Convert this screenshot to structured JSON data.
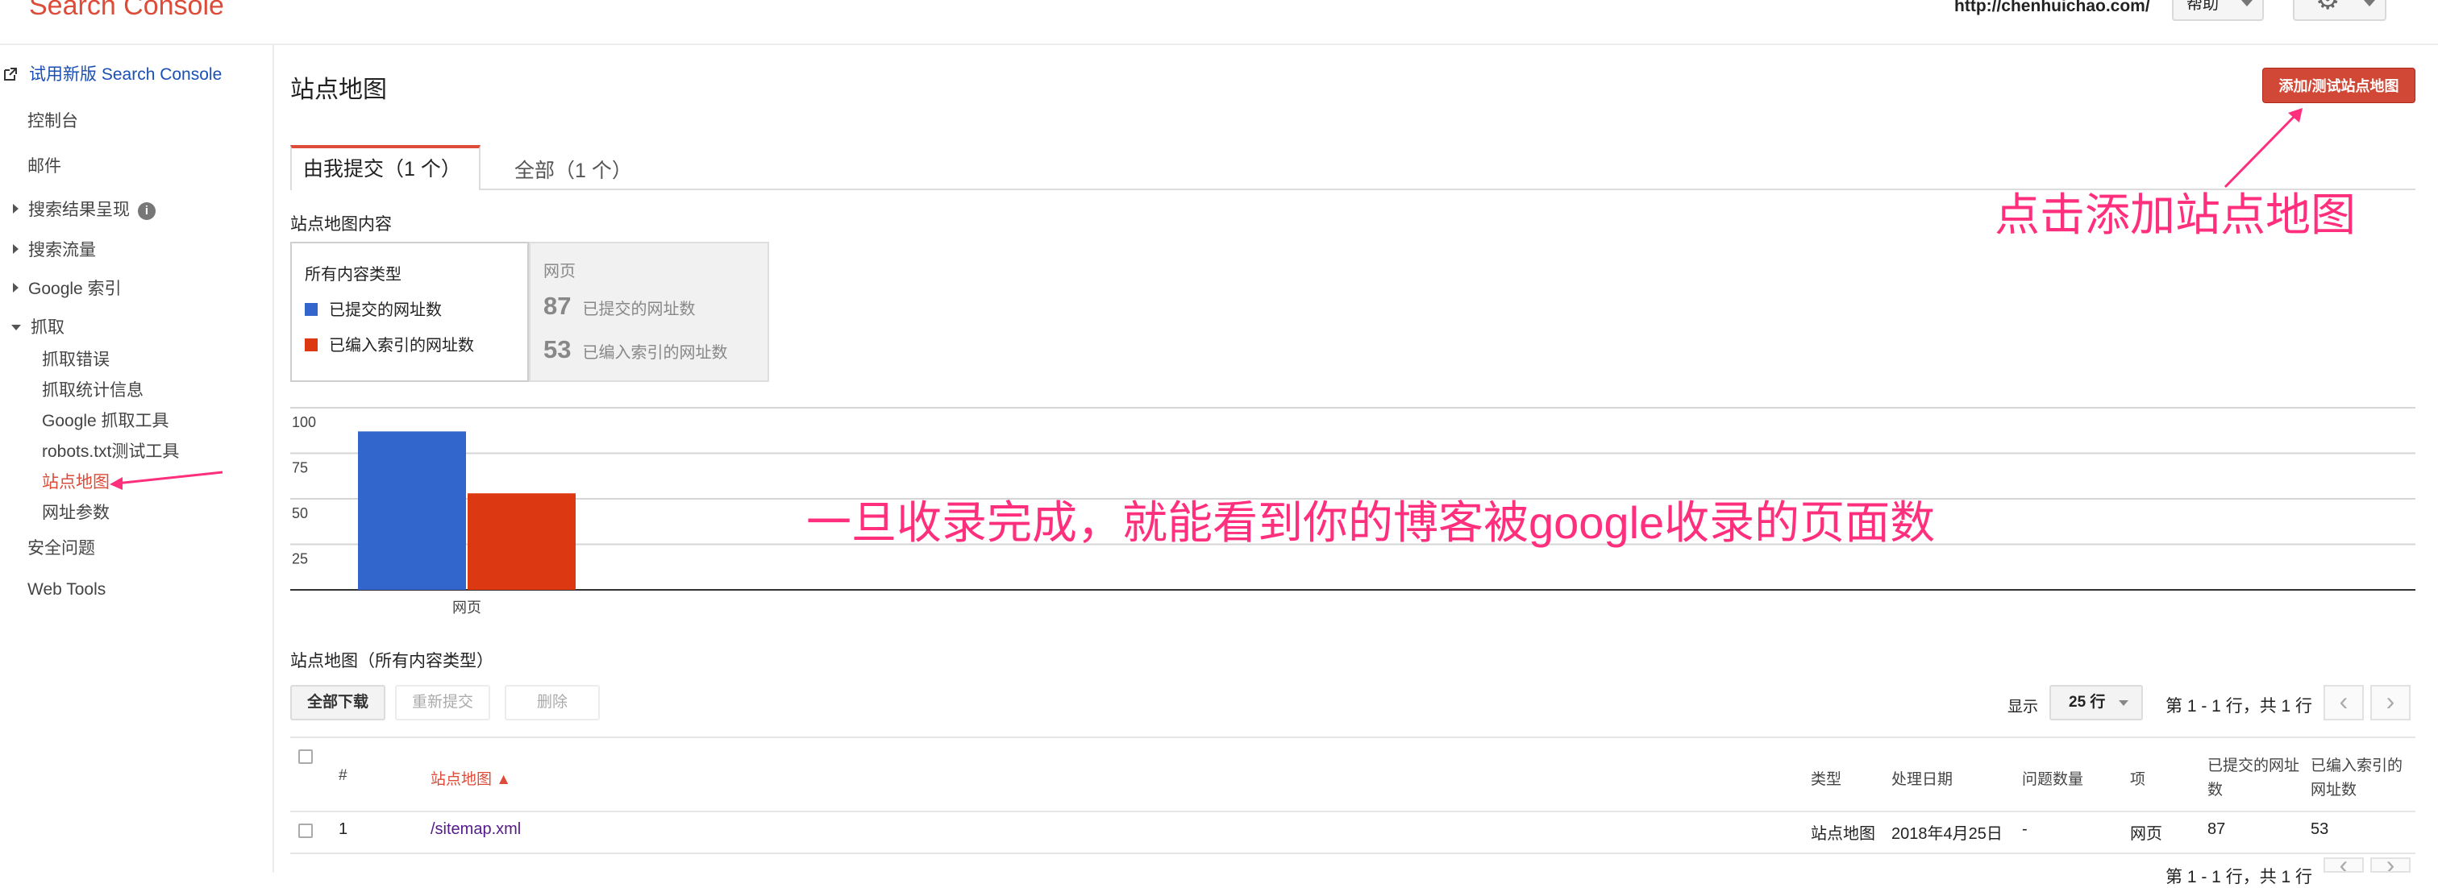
{
  "header": {
    "logo": "Search Console",
    "site_url": "http://chenhuichao.com/",
    "help_label": "帮助",
    "settings_icon": "gear-icon"
  },
  "sidebar": {
    "try_new": "试用新版 Search Console",
    "items": [
      {
        "label": "控制台"
      },
      {
        "label": "邮件"
      },
      {
        "label": "搜索结果呈现"
      },
      {
        "label": "搜索流量"
      },
      {
        "label": "Google 索引"
      },
      {
        "label": "抓取"
      },
      {
        "label": "抓取错误"
      },
      {
        "label": "抓取统计信息"
      },
      {
        "label": "Google 抓取工具"
      },
      {
        "label": "robots.txt测试工具"
      },
      {
        "label": "站点地图"
      },
      {
        "label": "网址参数"
      },
      {
        "label": "安全问题"
      },
      {
        "label": "Web Tools"
      }
    ],
    "info_glyph": "i"
  },
  "main": {
    "title": "站点地图",
    "add_button": "添加/测试站点地图",
    "tabs": [
      {
        "label": "由我提交（1 个）"
      },
      {
        "label": "全部（1 个）"
      }
    ],
    "content_section": "站点地图内容",
    "legend": {
      "header": "所有内容类型",
      "submitted": "已提交的网址数",
      "indexed": "已编入索引的网址数",
      "submitted_color": "#3366cc",
      "indexed_color": "#dc3912"
    },
    "stats": {
      "header": "网页",
      "submitted_value": "87",
      "submitted_label": "已提交的网址数",
      "indexed_value": "53",
      "indexed_label": "已编入索引的网址数"
    },
    "table_section": "站点地图（所有内容类型）",
    "toolbar": {
      "download_all": "全部下载",
      "resubmit": "重新提交",
      "delete": "删除",
      "show_label": "显示",
      "rows_per_page": "25 行",
      "pagination": "第 1 - 1 行，共 1 行",
      "prev_glyph": "‹",
      "next_glyph": "›"
    },
    "table": {
      "columns": [
        "#",
        "站点地图 ▲",
        "类型",
        "处理日期",
        "问题数量",
        "项",
        "已提交的网址数",
        "已编入索引的网址数"
      ],
      "rows": [
        {
          "num": "1",
          "sitemap": "/sitemap.xml",
          "type": "站点地图",
          "date": "2018年4月25日",
          "issues": "-",
          "item": "网页",
          "submitted": "87",
          "indexed": "53"
        }
      ]
    }
  },
  "annotations": {
    "add_sitemap": "点击添加站点地图",
    "indexed_note": "一旦收录完成，就能看到你的博客被google收录的页面数"
  },
  "chart_data": {
    "type": "bar",
    "categories": [
      "网页"
    ],
    "series": [
      {
        "name": "已提交的网址数",
        "values": [
          87
        ],
        "color": "#3366cc"
      },
      {
        "name": "已编入索引的网址数",
        "values": [
          53
        ],
        "color": "#dc3912"
      }
    ],
    "ylim": [
      0,
      100
    ],
    "yticks": [
      25,
      50,
      75,
      100
    ],
    "grid": true,
    "legend": "left"
  }
}
